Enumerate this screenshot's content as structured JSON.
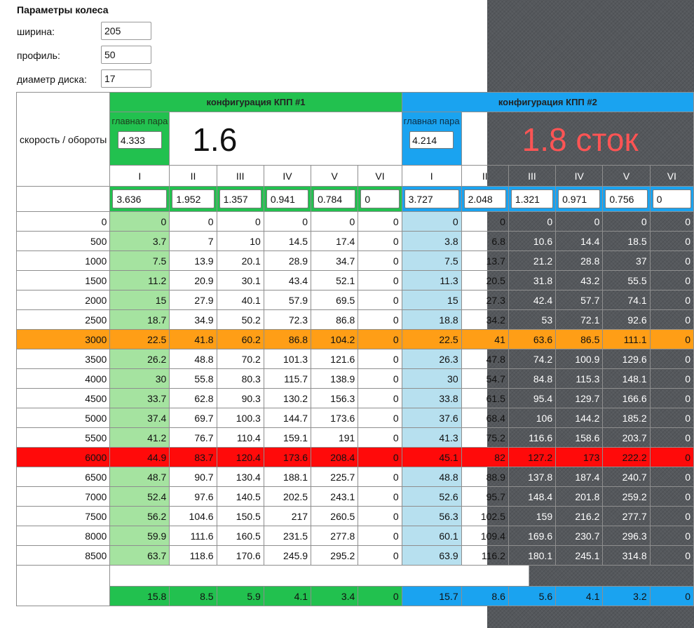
{
  "wheel": {
    "title": "Параметры колеса",
    "width_label": "ширина:",
    "width_value": "205",
    "profile_label": "профиль:",
    "profile_value": "50",
    "diameter_label": "диаметр диска:",
    "diameter_value": "17"
  },
  "speed_label": "скорость / обороты",
  "config1": {
    "title": "конфигурация КПП #1",
    "main_pair_label": "главная пара",
    "main_pair_value": "4.333",
    "big_value": "1.6"
  },
  "config2": {
    "title": "конфигурация КПП #2",
    "main_pair_label": "главная пара",
    "main_pair_value": "4.214",
    "big_value": "1.8 сток"
  },
  "gear_labels": [
    "I",
    "II",
    "III",
    "IV",
    "V",
    "VI",
    "I",
    "II",
    "III",
    "IV",
    "V",
    "VI"
  ],
  "gear_ratios": [
    "3.636",
    "1.952",
    "1.357",
    "0.941",
    "0.784",
    "0",
    "3.727",
    "2.048",
    "1.321",
    "0.971",
    "0.756",
    "0"
  ],
  "rows": [
    {
      "rpm": "0",
      "v": [
        "0",
        "0",
        "0",
        "0",
        "0",
        "0",
        "0",
        "0",
        "0",
        "0",
        "0",
        "0"
      ]
    },
    {
      "rpm": "500",
      "v": [
        "3.7",
        "7",
        "10",
        "14.5",
        "17.4",
        "0",
        "3.8",
        "6.8",
        "10.6",
        "14.4",
        "18.5",
        "0"
      ]
    },
    {
      "rpm": "1000",
      "v": [
        "7.5",
        "13.9",
        "20.1",
        "28.9",
        "34.7",
        "0",
        "7.5",
        "13.7",
        "21.2",
        "28.8",
        "37",
        "0"
      ]
    },
    {
      "rpm": "1500",
      "v": [
        "11.2",
        "20.9",
        "30.1",
        "43.4",
        "52.1",
        "0",
        "11.3",
        "20.5",
        "31.8",
        "43.2",
        "55.5",
        "0"
      ]
    },
    {
      "rpm": "2000",
      "v": [
        "15",
        "27.9",
        "40.1",
        "57.9",
        "69.5",
        "0",
        "15",
        "27.3",
        "42.4",
        "57.7",
        "74.1",
        "0"
      ]
    },
    {
      "rpm": "2500",
      "v": [
        "18.7",
        "34.9",
        "50.2",
        "72.3",
        "86.8",
        "0",
        "18.8",
        "34.2",
        "53",
        "72.1",
        "92.6",
        "0"
      ]
    },
    {
      "rpm": "3000",
      "hl": "orange",
      "v": [
        "22.5",
        "41.8",
        "60.2",
        "86.8",
        "104.2",
        "0",
        "22.5",
        "41",
        "63.6",
        "86.5",
        "111.1",
        "0"
      ]
    },
    {
      "rpm": "3500",
      "v": [
        "26.2",
        "48.8",
        "70.2",
        "101.3",
        "121.6",
        "0",
        "26.3",
        "47.8",
        "74.2",
        "100.9",
        "129.6",
        "0"
      ]
    },
    {
      "rpm": "4000",
      "v": [
        "30",
        "55.8",
        "80.3",
        "115.7",
        "138.9",
        "0",
        "30",
        "54.7",
        "84.8",
        "115.3",
        "148.1",
        "0"
      ]
    },
    {
      "rpm": "4500",
      "v": [
        "33.7",
        "62.8",
        "90.3",
        "130.2",
        "156.3",
        "0",
        "33.8",
        "61.5",
        "95.4",
        "129.7",
        "166.6",
        "0"
      ]
    },
    {
      "rpm": "5000",
      "v": [
        "37.4",
        "69.7",
        "100.3",
        "144.7",
        "173.6",
        "0",
        "37.6",
        "68.4",
        "106",
        "144.2",
        "185.2",
        "0"
      ]
    },
    {
      "rpm": "5500",
      "v": [
        "41.2",
        "76.7",
        "110.4",
        "159.1",
        "191",
        "0",
        "41.3",
        "75.2",
        "116.6",
        "158.6",
        "203.7",
        "0"
      ]
    },
    {
      "rpm": "6000",
      "hl": "red",
      "v": [
        "44.9",
        "83.7",
        "120.4",
        "173.6",
        "208.4",
        "0",
        "45.1",
        "82",
        "127.2",
        "173",
        "222.2",
        "0"
      ]
    },
    {
      "rpm": "6500",
      "v": [
        "48.7",
        "90.7",
        "130.4",
        "188.1",
        "225.7",
        "0",
        "48.8",
        "88.9",
        "137.8",
        "187.4",
        "240.7",
        "0"
      ]
    },
    {
      "rpm": "7000",
      "v": [
        "52.4",
        "97.6",
        "140.5",
        "202.5",
        "243.1",
        "0",
        "52.6",
        "95.7",
        "148.4",
        "201.8",
        "259.2",
        "0"
      ]
    },
    {
      "rpm": "7500",
      "v": [
        "56.2",
        "104.6",
        "150.5",
        "217",
        "260.5",
        "0",
        "56.3",
        "102.5",
        "159",
        "216.2",
        "277.7",
        "0"
      ]
    },
    {
      "rpm": "8000",
      "v": [
        "59.9",
        "111.6",
        "160.5",
        "231.5",
        "277.8",
        "0",
        "60.1",
        "109.4",
        "169.6",
        "230.7",
        "296.3",
        "0"
      ]
    },
    {
      "rpm": "8500",
      "v": [
        "63.7",
        "118.6",
        "170.6",
        "245.9",
        "295.2",
        "0",
        "63.9",
        "116.2",
        "180.1",
        "245.1",
        "314.8",
        "0"
      ]
    }
  ],
  "footer": [
    "15.8",
    "8.5",
    "5.9",
    "4.1",
    "3.4",
    "0",
    "15.7",
    "8.6",
    "5.6",
    "4.1",
    "3.2",
    "0"
  ],
  "colors": {
    "green": "#22c14f",
    "light_green": "#a5e3a0",
    "blue": "#1aa3f0",
    "light_blue": "#b7e0ef",
    "orange": "#ff9e16",
    "red": "#ff0a0a",
    "ratio2_text": "#ff5454",
    "dark_background": "#55585c"
  }
}
